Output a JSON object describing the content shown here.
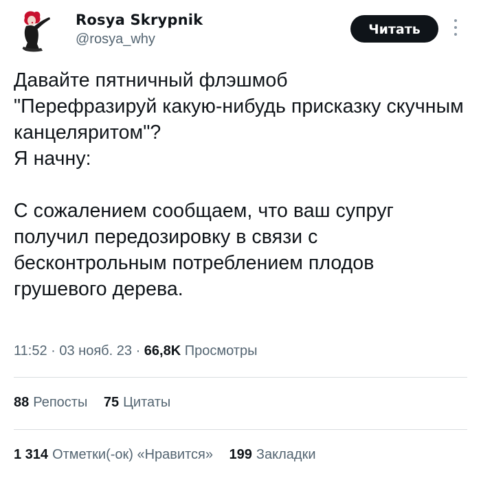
{
  "author": {
    "display_name": "Rosya Skrypnik",
    "handle": "@rosya_why",
    "avatar_icon": "woman-silhouette-avatar"
  },
  "follow_button": {
    "label": "Читать"
  },
  "more_icon": "more-vertical-icon",
  "tweet": {
    "text": "Давайте пятничный флэшмоб\n\"Перефразируй какую-нибудь присказку скучным канцеляритом\"?\nЯ начну:\n\nС сожалением сообщаем, что ваш супруг получил передозировку в связи с бесконтрольным потреблением плодов грушевого дерева."
  },
  "meta": {
    "time": "11:52",
    "separator": "·",
    "date": "03 нояб. 23",
    "views_count": "66,8K",
    "views_label": "Просмотры"
  },
  "stats_row1": {
    "reposts_count": "88",
    "reposts_label": "Репосты",
    "quotes_count": "75",
    "quotes_label": "Цитаты"
  },
  "stats_row2": {
    "likes_count": "1 314",
    "likes_label": "Отметки(-ок) «Нравится»",
    "bookmarks_count": "199",
    "bookmarks_label": "Закладки"
  },
  "colors": {
    "text_primary": "#0f1419",
    "text_secondary": "#536471",
    "button_bg": "#0f1419",
    "button_text": "#ffffff",
    "divider": "#d9dde0",
    "avatar_accent": "#c8102e"
  }
}
